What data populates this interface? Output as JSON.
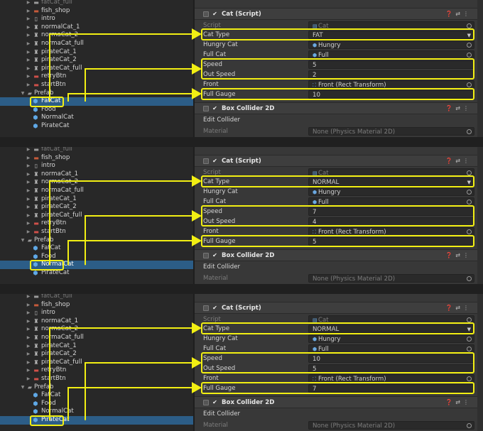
{
  "panels": [
    {
      "hierarchy": [
        {
          "label": "fatCat_full",
          "icon": "sprite",
          "type": "child",
          "dim": true
        },
        {
          "label": "fish_shop",
          "icon": "shop",
          "type": "child"
        },
        {
          "label": "intro",
          "icon": "image",
          "type": "child"
        },
        {
          "label": "normalCat_1",
          "icon": "cat-sprite",
          "type": "child"
        },
        {
          "label": "normaCat_2",
          "icon": "cat-sprite",
          "type": "child"
        },
        {
          "label": "normaCat_full",
          "icon": "cat-sprite",
          "type": "child"
        },
        {
          "label": "pirateCat_1",
          "icon": "cat-sprite",
          "type": "child"
        },
        {
          "label": "pirateCat_2",
          "icon": "cat-sprite",
          "type": "child"
        },
        {
          "label": "pirateCat_full",
          "icon": "cat-sprite",
          "type": "child"
        },
        {
          "label": "retryBtn",
          "icon": "button-sprite",
          "type": "child"
        },
        {
          "label": "startBtn",
          "icon": "button-sprite",
          "type": "child"
        },
        {
          "label": "Prefab",
          "icon": "folder",
          "type": "folder"
        },
        {
          "label": "FatCat",
          "icon": "prefab",
          "type": "prefab",
          "selected": true
        },
        {
          "label": "Food",
          "icon": "prefab",
          "type": "prefab"
        },
        {
          "label": "NormalCat",
          "icon": "prefab",
          "type": "prefab"
        },
        {
          "label": "PirateCat",
          "icon": "prefab",
          "type": "prefab"
        }
      ],
      "props": {
        "script": "Cat",
        "cat_type": "FAT",
        "hungry_cat": "Hungry",
        "full_cat": "Full",
        "speed": "5",
        "out_speed": "2",
        "front": "Front (Rect Transform)",
        "full_gauge": "10"
      }
    },
    {
      "hierarchy": [
        {
          "label": "fatCat_full",
          "icon": "sprite",
          "type": "child",
          "dim": true
        },
        {
          "label": "fish_shop",
          "icon": "shop",
          "type": "child"
        },
        {
          "label": "intro",
          "icon": "image",
          "type": "child"
        },
        {
          "label": "normaCat_1",
          "icon": "cat-sprite",
          "type": "child"
        },
        {
          "label": "normaCat_2",
          "icon": "cat-sprite",
          "type": "child"
        },
        {
          "label": "normaCat_full",
          "icon": "cat-sprite",
          "type": "child"
        },
        {
          "label": "pirateCat_1",
          "icon": "cat-sprite",
          "type": "child"
        },
        {
          "label": "pirateCat_2",
          "icon": "cat-sprite",
          "type": "child"
        },
        {
          "label": "pirateCat_full",
          "icon": "cat-sprite",
          "type": "child"
        },
        {
          "label": "retryBtn",
          "icon": "button-sprite",
          "type": "child"
        },
        {
          "label": "startBtn",
          "icon": "button-sprite",
          "type": "child"
        },
        {
          "label": "Prefab",
          "icon": "folder",
          "type": "folder"
        },
        {
          "label": "FatCat",
          "icon": "prefab",
          "type": "prefab"
        },
        {
          "label": "Food",
          "icon": "prefab",
          "type": "prefab"
        },
        {
          "label": "NormalCat",
          "icon": "prefab",
          "type": "prefab",
          "selected": true
        },
        {
          "label": "PirateCat",
          "icon": "prefab",
          "type": "prefab"
        }
      ],
      "props": {
        "script": "Cat",
        "cat_type": "NORMAL",
        "hungry_cat": "Hungry",
        "full_cat": "Full",
        "speed": "7",
        "out_speed": "4",
        "front": "Front (Rect Transform)",
        "full_gauge": "5"
      }
    },
    {
      "hierarchy": [
        {
          "label": "fatCat_full",
          "icon": "sprite",
          "type": "child",
          "dim": true
        },
        {
          "label": "fish_shop",
          "icon": "shop",
          "type": "child"
        },
        {
          "label": "intro",
          "icon": "image",
          "type": "child"
        },
        {
          "label": "normaCat_1",
          "icon": "cat-sprite",
          "type": "child"
        },
        {
          "label": "normaCat_2",
          "icon": "cat-sprite",
          "type": "child"
        },
        {
          "label": "normaCat_full",
          "icon": "cat-sprite",
          "type": "child"
        },
        {
          "label": "pirateCat_1",
          "icon": "cat-sprite",
          "type": "child"
        },
        {
          "label": "pirateCat_2",
          "icon": "cat-sprite",
          "type": "child"
        },
        {
          "label": "pirateCat_full",
          "icon": "cat-sprite",
          "type": "child"
        },
        {
          "label": "retryBtn",
          "icon": "button-sprite",
          "type": "child"
        },
        {
          "label": "startBtn",
          "icon": "button-sprite",
          "type": "child"
        },
        {
          "label": "Prefab",
          "icon": "folder",
          "type": "folder"
        },
        {
          "label": "FatCat",
          "icon": "prefab",
          "type": "prefab"
        },
        {
          "label": "Food",
          "icon": "prefab",
          "type": "prefab"
        },
        {
          "label": "NormalCat",
          "icon": "prefab",
          "type": "prefab"
        },
        {
          "label": "PirateCat",
          "icon": "prefab",
          "type": "prefab",
          "selected": true
        }
      ],
      "props": {
        "script": "Cat",
        "cat_type": "NORMAL",
        "hungry_cat": "Hungry",
        "full_cat": "Full",
        "speed": "10",
        "out_speed": "5",
        "front": "Front (Rect Transform)",
        "full_gauge": "7"
      }
    }
  ],
  "labels": {
    "script": "Script",
    "cat_type": "Cat Type",
    "hungry_cat": "Hungry Cat",
    "full_cat": "Full Cat",
    "speed": "Speed",
    "out_speed": "Out Speed",
    "front": "Front",
    "full_gauge": "Full Gauge",
    "cat_script_title": "Cat (Script)",
    "box_collider_title": "Box Collider 2D",
    "edit_collider": "Edit Collider",
    "material": "Material",
    "material_value": "None (Physics Material 2D)"
  },
  "tool_icons": [
    "help-icon",
    "preset-icon",
    "kebab-menu-icon"
  ],
  "colors": {
    "highlight": "#f2ef13",
    "selected_row": "#2c5d87",
    "inspector_bg": "#383838",
    "hierarchy_bg": "#282828"
  }
}
